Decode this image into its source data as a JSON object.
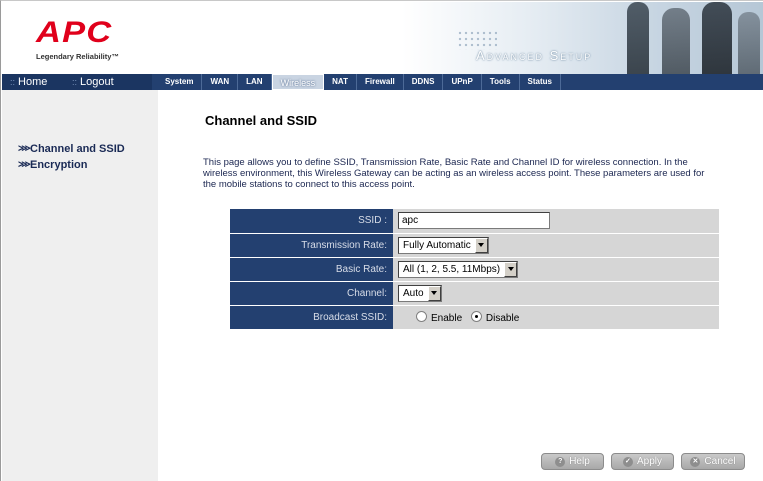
{
  "brand": {
    "logo_text": "APC",
    "tagline": "Legendary Reliability™",
    "header_title": "Advanced Setup",
    "logo_color": "#e0001b"
  },
  "topnav": {
    "home_label": "Home",
    "logout_label": "Logout",
    "tabs": [
      "System",
      "WAN",
      "LAN",
      "Wireless",
      "NAT",
      "Firewall",
      "DDNS",
      "UPnP",
      "Tools",
      "Status"
    ],
    "active_tab": "Wireless"
  },
  "sidebar": {
    "items": [
      {
        "label": "Channel and SSID"
      },
      {
        "label": "Encryption"
      }
    ]
  },
  "main": {
    "title": "Channel and SSID",
    "intro": "This page allows you to define SSID, Transmission Rate, Basic Rate and Channel ID for wireless connection.  In the wireless environment, this Wireless Gateway can be acting as an wireless access point.  These parameters are used for the mobile stations to connect to this access point."
  },
  "form": {
    "ssid": {
      "label": "SSID :",
      "value": "apc"
    },
    "tx_rate": {
      "label": "Transmission Rate:",
      "value": "Fully Automatic"
    },
    "basic_rate": {
      "label": "Basic Rate:",
      "value": "All (1, 2, 5.5, 11Mbps)"
    },
    "channel": {
      "label": "Channel:",
      "value": "Auto"
    },
    "broadcast": {
      "label": "Broadcast SSID:",
      "enable_label": "Enable",
      "disable_label": "Disable",
      "selected": "Disable"
    }
  },
  "buttons": {
    "help": "Help",
    "apply": "Apply",
    "cancel": "Cancel"
  },
  "colors": {
    "nav_bg": "#234070",
    "label_cell_bg": "#234070",
    "value_cell_bg": "#d6d6d6",
    "sidebar_bg": "#efefef"
  }
}
